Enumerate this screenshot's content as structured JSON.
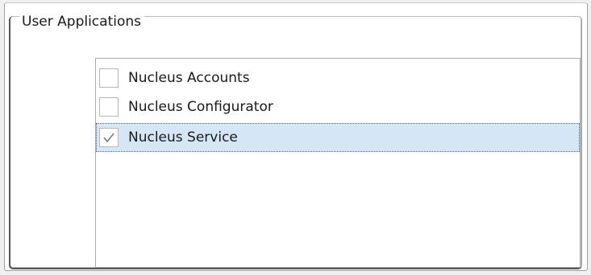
{
  "groupbox": {
    "title": "User Applications"
  },
  "applications": [
    {
      "label": "Nucleus Accounts",
      "checked": false,
      "selected": false
    },
    {
      "label": "Nucleus Configurator",
      "checked": false,
      "selected": false
    },
    {
      "label": "Nucleus Service",
      "checked": true,
      "selected": true
    }
  ],
  "colors": {
    "selection_background": "#d5e6f7",
    "checkmark": "#7a7a7a"
  },
  "icons": {
    "check": "checkmark-icon"
  }
}
